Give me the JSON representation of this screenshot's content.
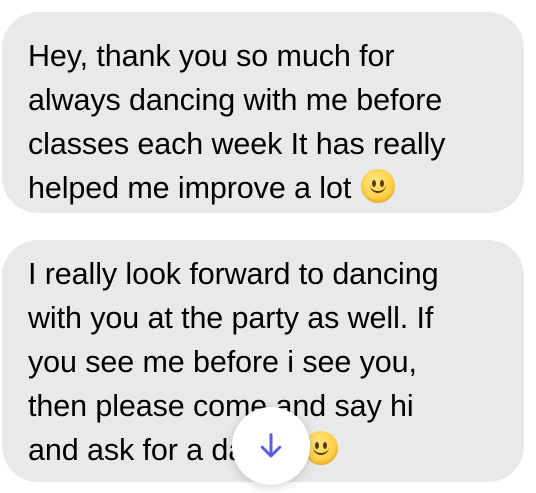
{
  "messages": [
    {
      "lines": [
        "Hey, thank you so much for",
        "always dancing with me before",
        "classes each week  It has really",
        "helped me improve a lot"
      ],
      "emoji": "slightly-smiling-face"
    },
    {
      "lines": [
        "I really look forward to dancing",
        "with you at the party as well. If",
        "you see me before i see you,",
        "then please come and say hi",
        "and ask for a dance"
      ],
      "emoji": "slightly-smiling-face"
    }
  ],
  "scroll_button": {
    "icon": "arrow-down-icon",
    "color": "#5b5ce6"
  },
  "colors": {
    "bubble": "#e9e9eb",
    "text": "#000000",
    "background": "#ffffff"
  }
}
